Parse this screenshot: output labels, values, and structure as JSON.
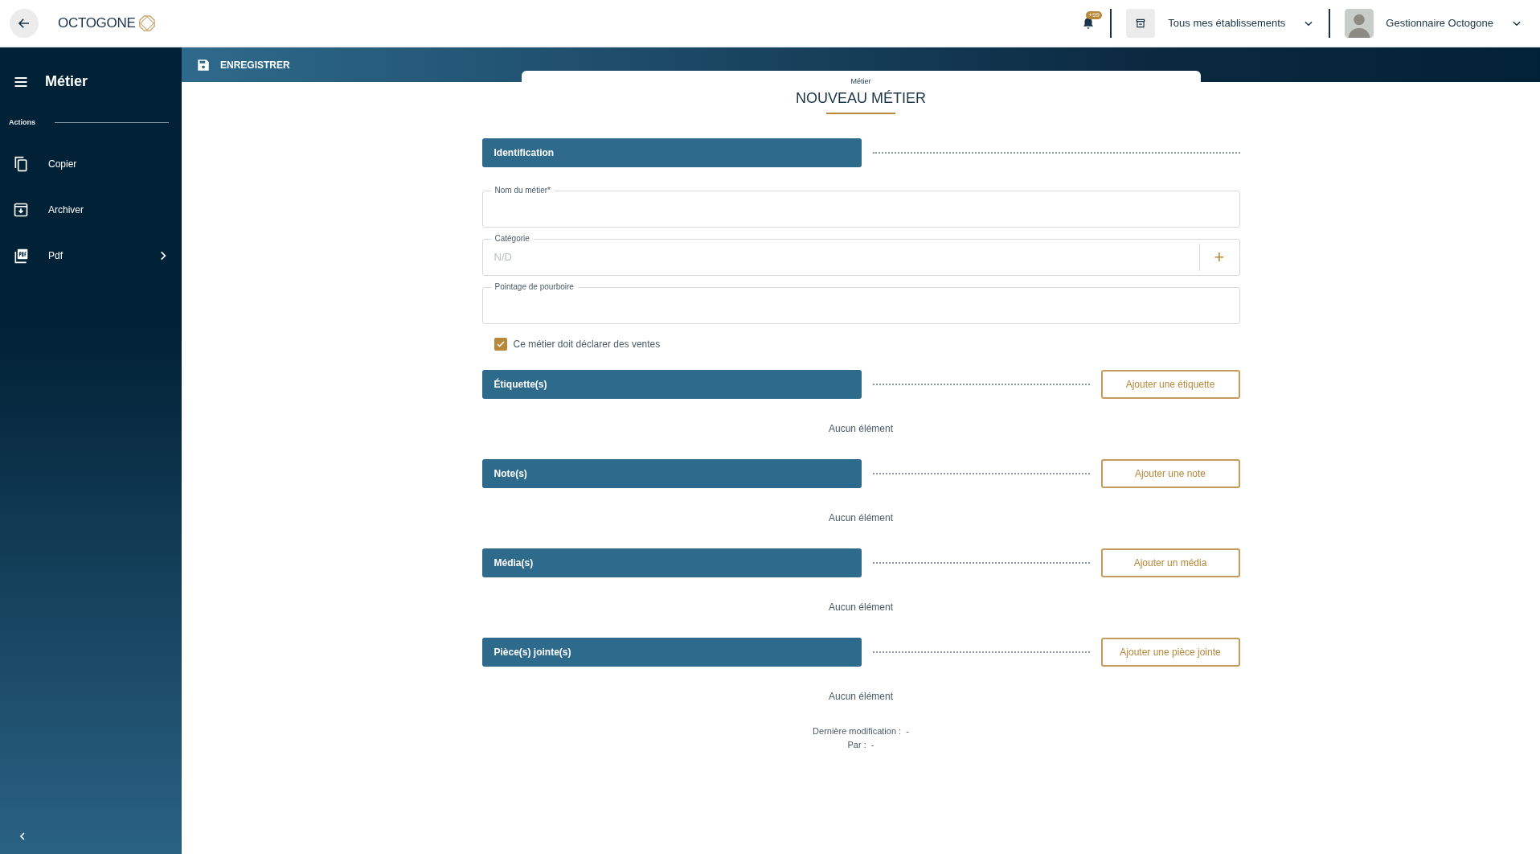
{
  "header": {
    "logo": "OCTOGONE",
    "notification_count": "+99",
    "establishment": "Tous mes établissements",
    "user": "Gestionnaire Octogone"
  },
  "toolbar": {
    "save": "ENREGISTRER"
  },
  "sidebar": {
    "title": "Métier",
    "section": "Actions",
    "items": [
      {
        "label": "Copier",
        "kind": "copy",
        "has_submenu": false
      },
      {
        "label": "Archiver",
        "kind": "archive",
        "has_submenu": false
      },
      {
        "label": "Pdf",
        "kind": "pdf",
        "has_submenu": true
      }
    ]
  },
  "form": {
    "subtitle": "Métier",
    "title": "NOUVEAU MÉTIER",
    "identification": "Identification",
    "fields": [
      {
        "label": "Nom du métier*",
        "kind": "text"
      },
      {
        "label": "Catégorie",
        "kind": "add",
        "placeholder": "N/D",
        "addon": "+"
      },
      {
        "label": "Pointage de pourboire",
        "kind": "text"
      }
    ],
    "checkbox": {
      "label": "Ce métier doit déclarer des ventes",
      "checked": true
    },
    "sections": [
      {
        "title": "Étiquette(s)",
        "button": "Ajouter une étiquette",
        "empty": "Aucun élément"
      },
      {
        "title": "Note(s)",
        "button": "Ajouter une note",
        "empty": "Aucun élément"
      },
      {
        "title": "Média(s)",
        "button": "Ajouter un média",
        "empty": "Aucun élément"
      },
      {
        "title": "Pièce(s) jointe(s)",
        "button": "Ajouter une pièce jointe",
        "empty": "Aucun élément"
      }
    ],
    "footer": {
      "modified_label": "Dernière modification :",
      "modified_value": "-",
      "by_label": "Par :",
      "by_value": "-"
    }
  }
}
